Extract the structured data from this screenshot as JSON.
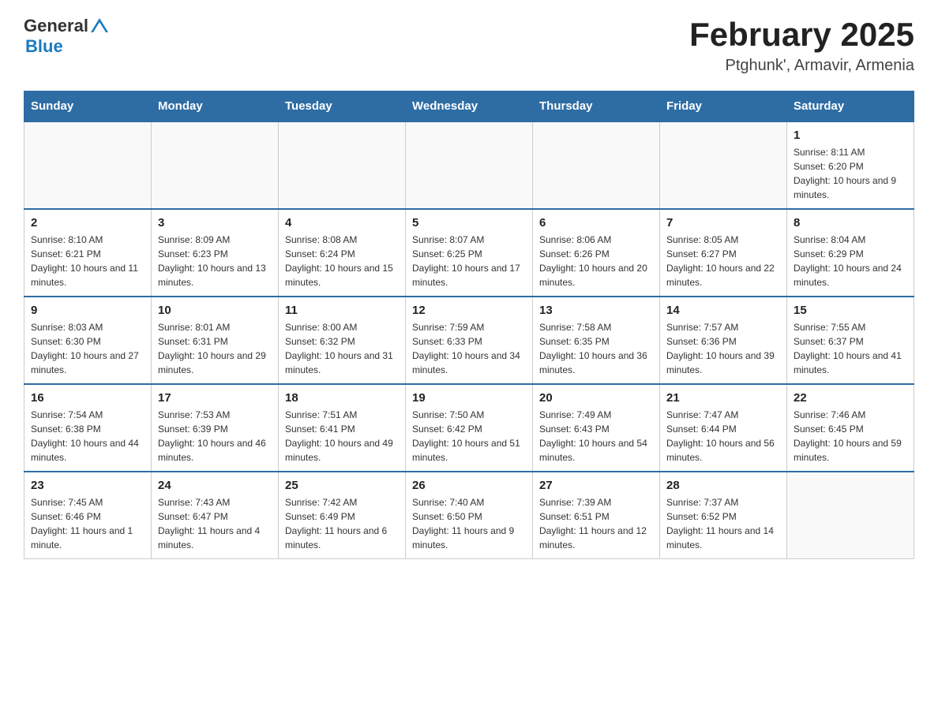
{
  "header": {
    "logo_general": "General",
    "logo_blue": "Blue",
    "month_title": "February 2025",
    "location": "Ptghunk', Armavir, Armenia"
  },
  "days_of_week": [
    "Sunday",
    "Monday",
    "Tuesday",
    "Wednesday",
    "Thursday",
    "Friday",
    "Saturday"
  ],
  "weeks": [
    [
      {
        "day": "",
        "sunrise": "",
        "sunset": "",
        "daylight": ""
      },
      {
        "day": "",
        "sunrise": "",
        "sunset": "",
        "daylight": ""
      },
      {
        "day": "",
        "sunrise": "",
        "sunset": "",
        "daylight": ""
      },
      {
        "day": "",
        "sunrise": "",
        "sunset": "",
        "daylight": ""
      },
      {
        "day": "",
        "sunrise": "",
        "sunset": "",
        "daylight": ""
      },
      {
        "day": "",
        "sunrise": "",
        "sunset": "",
        "daylight": ""
      },
      {
        "day": "1",
        "sunrise": "Sunrise: 8:11 AM",
        "sunset": "Sunset: 6:20 PM",
        "daylight": "Daylight: 10 hours and 9 minutes."
      }
    ],
    [
      {
        "day": "2",
        "sunrise": "Sunrise: 8:10 AM",
        "sunset": "Sunset: 6:21 PM",
        "daylight": "Daylight: 10 hours and 11 minutes."
      },
      {
        "day": "3",
        "sunrise": "Sunrise: 8:09 AM",
        "sunset": "Sunset: 6:23 PM",
        "daylight": "Daylight: 10 hours and 13 minutes."
      },
      {
        "day": "4",
        "sunrise": "Sunrise: 8:08 AM",
        "sunset": "Sunset: 6:24 PM",
        "daylight": "Daylight: 10 hours and 15 minutes."
      },
      {
        "day": "5",
        "sunrise": "Sunrise: 8:07 AM",
        "sunset": "Sunset: 6:25 PM",
        "daylight": "Daylight: 10 hours and 17 minutes."
      },
      {
        "day": "6",
        "sunrise": "Sunrise: 8:06 AM",
        "sunset": "Sunset: 6:26 PM",
        "daylight": "Daylight: 10 hours and 20 minutes."
      },
      {
        "day": "7",
        "sunrise": "Sunrise: 8:05 AM",
        "sunset": "Sunset: 6:27 PM",
        "daylight": "Daylight: 10 hours and 22 minutes."
      },
      {
        "day": "8",
        "sunrise": "Sunrise: 8:04 AM",
        "sunset": "Sunset: 6:29 PM",
        "daylight": "Daylight: 10 hours and 24 minutes."
      }
    ],
    [
      {
        "day": "9",
        "sunrise": "Sunrise: 8:03 AM",
        "sunset": "Sunset: 6:30 PM",
        "daylight": "Daylight: 10 hours and 27 minutes."
      },
      {
        "day": "10",
        "sunrise": "Sunrise: 8:01 AM",
        "sunset": "Sunset: 6:31 PM",
        "daylight": "Daylight: 10 hours and 29 minutes."
      },
      {
        "day": "11",
        "sunrise": "Sunrise: 8:00 AM",
        "sunset": "Sunset: 6:32 PM",
        "daylight": "Daylight: 10 hours and 31 minutes."
      },
      {
        "day": "12",
        "sunrise": "Sunrise: 7:59 AM",
        "sunset": "Sunset: 6:33 PM",
        "daylight": "Daylight: 10 hours and 34 minutes."
      },
      {
        "day": "13",
        "sunrise": "Sunrise: 7:58 AM",
        "sunset": "Sunset: 6:35 PM",
        "daylight": "Daylight: 10 hours and 36 minutes."
      },
      {
        "day": "14",
        "sunrise": "Sunrise: 7:57 AM",
        "sunset": "Sunset: 6:36 PM",
        "daylight": "Daylight: 10 hours and 39 minutes."
      },
      {
        "day": "15",
        "sunrise": "Sunrise: 7:55 AM",
        "sunset": "Sunset: 6:37 PM",
        "daylight": "Daylight: 10 hours and 41 minutes."
      }
    ],
    [
      {
        "day": "16",
        "sunrise": "Sunrise: 7:54 AM",
        "sunset": "Sunset: 6:38 PM",
        "daylight": "Daylight: 10 hours and 44 minutes."
      },
      {
        "day": "17",
        "sunrise": "Sunrise: 7:53 AM",
        "sunset": "Sunset: 6:39 PM",
        "daylight": "Daylight: 10 hours and 46 minutes."
      },
      {
        "day": "18",
        "sunrise": "Sunrise: 7:51 AM",
        "sunset": "Sunset: 6:41 PM",
        "daylight": "Daylight: 10 hours and 49 minutes."
      },
      {
        "day": "19",
        "sunrise": "Sunrise: 7:50 AM",
        "sunset": "Sunset: 6:42 PM",
        "daylight": "Daylight: 10 hours and 51 minutes."
      },
      {
        "day": "20",
        "sunrise": "Sunrise: 7:49 AM",
        "sunset": "Sunset: 6:43 PM",
        "daylight": "Daylight: 10 hours and 54 minutes."
      },
      {
        "day": "21",
        "sunrise": "Sunrise: 7:47 AM",
        "sunset": "Sunset: 6:44 PM",
        "daylight": "Daylight: 10 hours and 56 minutes."
      },
      {
        "day": "22",
        "sunrise": "Sunrise: 7:46 AM",
        "sunset": "Sunset: 6:45 PM",
        "daylight": "Daylight: 10 hours and 59 minutes."
      }
    ],
    [
      {
        "day": "23",
        "sunrise": "Sunrise: 7:45 AM",
        "sunset": "Sunset: 6:46 PM",
        "daylight": "Daylight: 11 hours and 1 minute."
      },
      {
        "day": "24",
        "sunrise": "Sunrise: 7:43 AM",
        "sunset": "Sunset: 6:47 PM",
        "daylight": "Daylight: 11 hours and 4 minutes."
      },
      {
        "day": "25",
        "sunrise": "Sunrise: 7:42 AM",
        "sunset": "Sunset: 6:49 PM",
        "daylight": "Daylight: 11 hours and 6 minutes."
      },
      {
        "day": "26",
        "sunrise": "Sunrise: 7:40 AM",
        "sunset": "Sunset: 6:50 PM",
        "daylight": "Daylight: 11 hours and 9 minutes."
      },
      {
        "day": "27",
        "sunrise": "Sunrise: 7:39 AM",
        "sunset": "Sunset: 6:51 PM",
        "daylight": "Daylight: 11 hours and 12 minutes."
      },
      {
        "day": "28",
        "sunrise": "Sunrise: 7:37 AM",
        "sunset": "Sunset: 6:52 PM",
        "daylight": "Daylight: 11 hours and 14 minutes."
      },
      {
        "day": "",
        "sunrise": "",
        "sunset": "",
        "daylight": ""
      }
    ]
  ]
}
